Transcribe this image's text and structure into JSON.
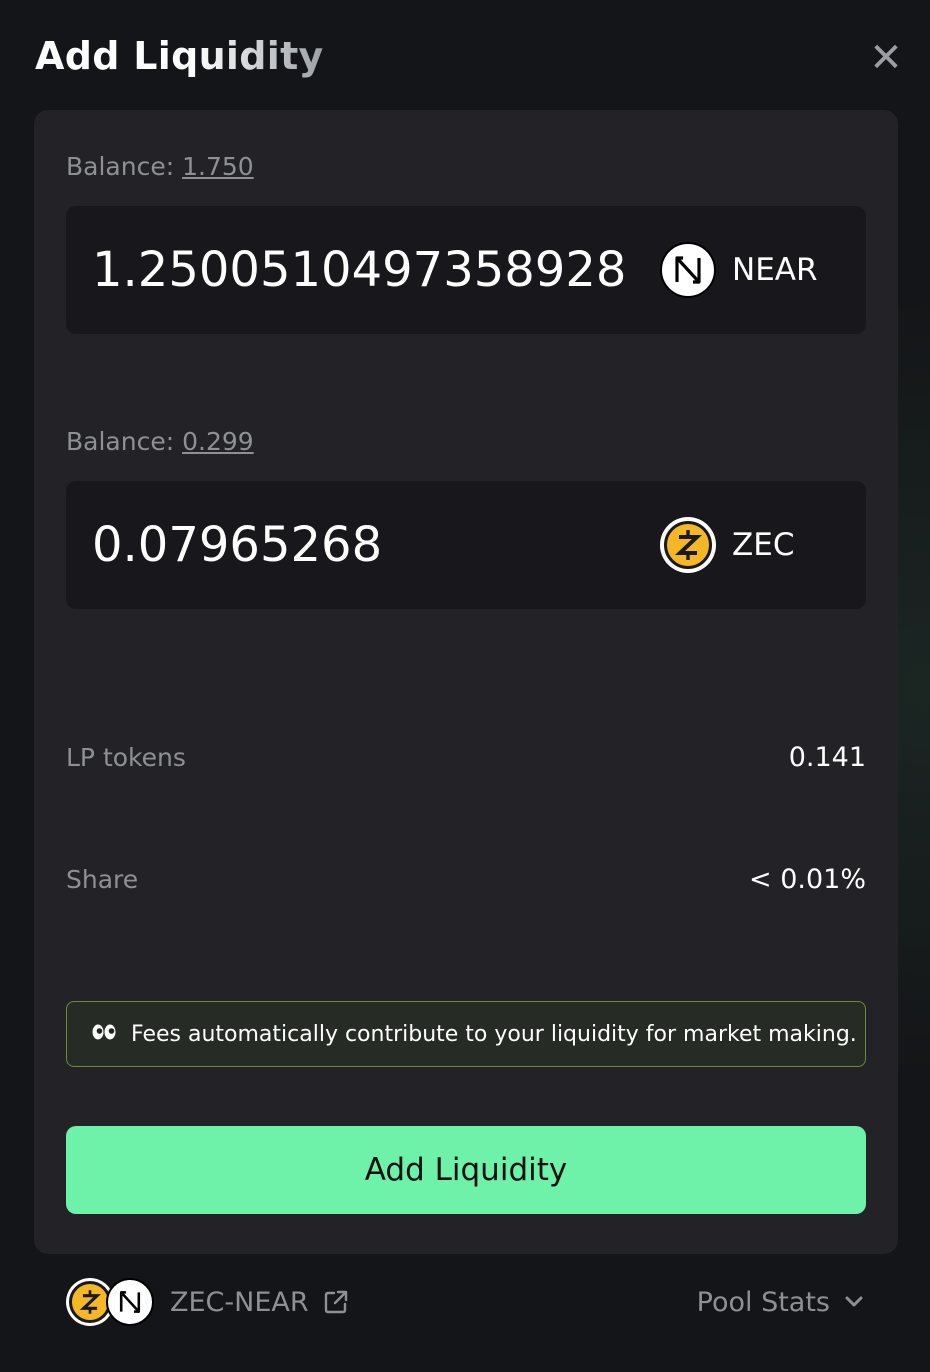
{
  "header": {
    "title": "Add Liquidity",
    "close_label": "✕"
  },
  "token_a": {
    "balance_label": "Balance:",
    "balance_value": "1.750",
    "amount": "1.2500510497358928",
    "symbol": "NEAR",
    "icon": "near-logo-icon"
  },
  "token_b": {
    "balance_label": "Balance:",
    "balance_value": "0.299",
    "amount": "0.07965268",
    "symbol": "ZEC",
    "icon": "zec-logo-icon"
  },
  "stats": {
    "lp_label": "LP tokens",
    "lp_value": "0.141",
    "share_label": "Share",
    "share_value": "< 0.01%"
  },
  "notice": {
    "icon": "eyes-emoji-icon",
    "text": "Fees automatically contribute to your liquidity for market making."
  },
  "actions": {
    "submit_label": "Add Liquidity"
  },
  "footer": {
    "pair_name": "ZEC-NEAR",
    "pool_stats_label": "Pool Stats"
  },
  "colors": {
    "accent": "#6ef1a8",
    "card_bg": "#222227",
    "input_bg": "#18181c",
    "muted_text": "#8e9094",
    "notice_border": "#6b8a3a",
    "zec_gold": "#f4b728"
  }
}
